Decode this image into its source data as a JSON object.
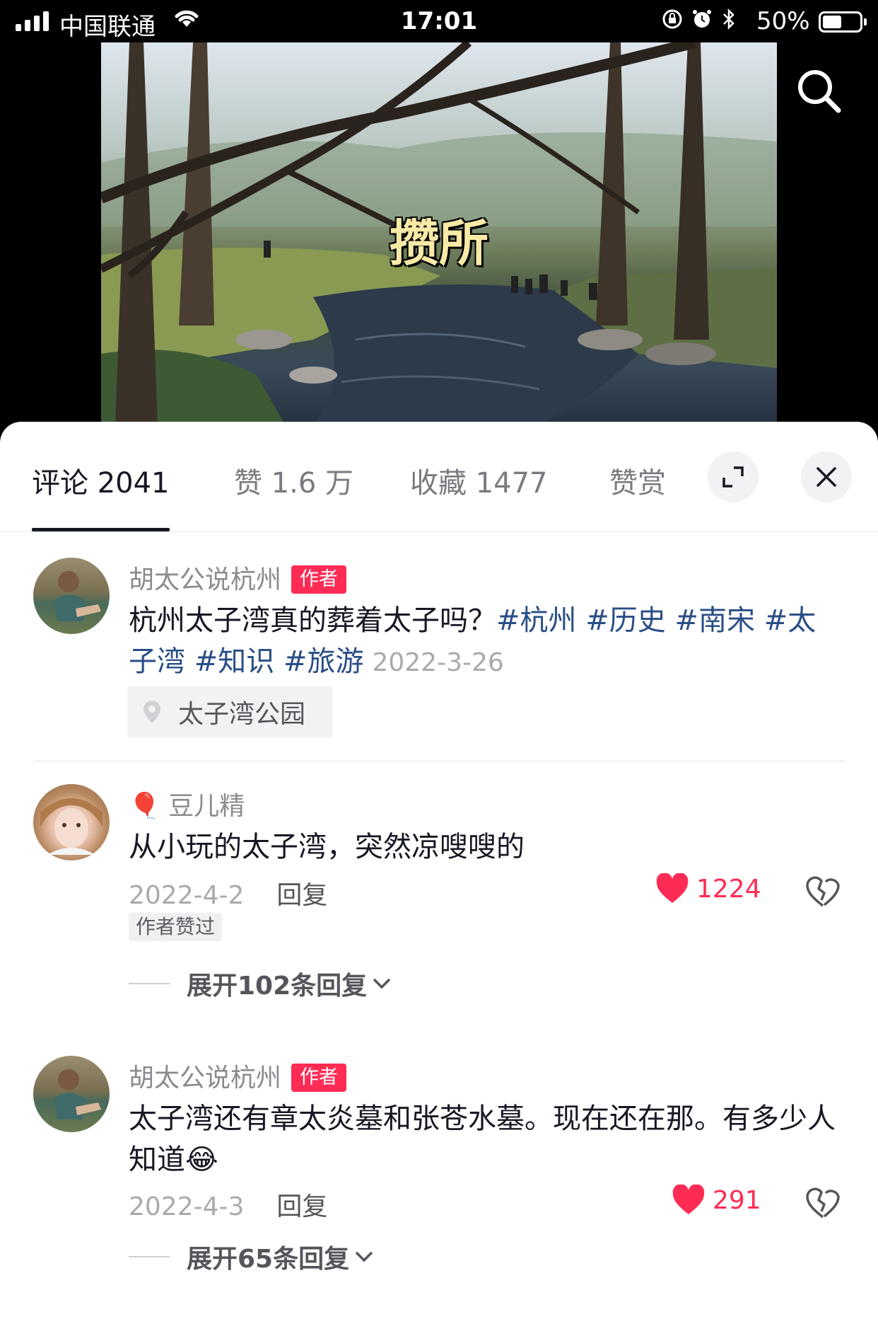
{
  "status_bar": {
    "carrier": "中国联通",
    "time": "17:01",
    "battery_percent": "50%",
    "battery_level": 0.5,
    "icons": [
      "signal-icon",
      "wifi-icon",
      "rotation-lock-icon",
      "alarm-icon",
      "bluetooth-icon",
      "battery-icon"
    ]
  },
  "video": {
    "caption": "攒所"
  },
  "tabs": [
    {
      "label": "评论 2041",
      "active": true
    },
    {
      "label": "赞 1.6 万",
      "active": false
    },
    {
      "label": "收藏 1477",
      "active": false
    },
    {
      "label": "赞赏（",
      "active": false
    }
  ],
  "post": {
    "username": "胡太公说杭州",
    "author_tag": "作者",
    "text": "杭州太子湾真的葬着太子吗？",
    "hashtags": [
      "#杭州",
      "#历史",
      "#南宋",
      "#太子湾",
      "#知识",
      "#旅游"
    ],
    "date": "2022-3-26",
    "location": "太子湾公园"
  },
  "comments": [
    {
      "emoji": "🎈",
      "username": "豆儿精",
      "text": "从小玩的太子湾，突然凉嗖嗖的",
      "date": "2022-4-2",
      "reply_label": "回复",
      "likes": "1224",
      "author_liked": "作者赞过",
      "expand_label": "展开102条回复"
    },
    {
      "username": "胡太公说杭州",
      "author_tag": "作者",
      "text": "太子湾还有章太炎墓和张苍水墓。现在还在那。有多少人知道",
      "text_emoji": "😂",
      "date": "2022-4-3",
      "reply_label": "回复",
      "likes": "291",
      "expand_label": "展开65条回复"
    }
  ],
  "colors": {
    "accent": "#fe2c55",
    "hashtag": "#2a4e86"
  }
}
